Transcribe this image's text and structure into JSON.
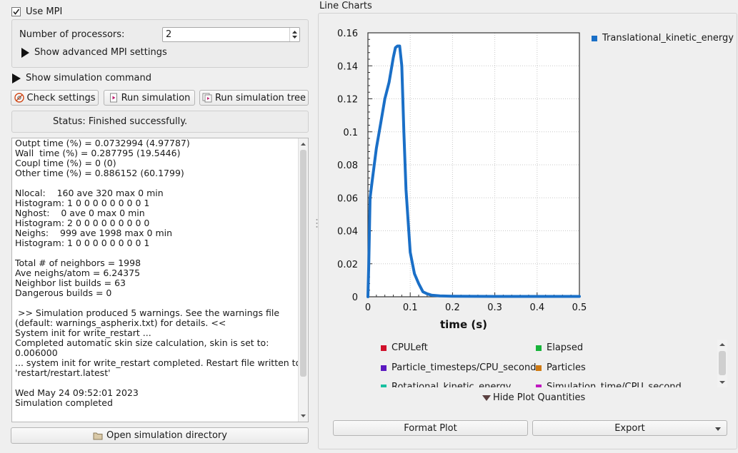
{
  "mpi": {
    "use_label": "Use MPI",
    "checked": true,
    "processors_label": "Number of processors:",
    "processors_value": "2",
    "advanced_label": "Show advanced MPI settings"
  },
  "sim": {
    "show_command_label": "Show simulation command"
  },
  "buttons": {
    "check": "Check settings",
    "run": "Run simulation",
    "run_tree": "Run simulation tree",
    "open_dir": "Open simulation directory"
  },
  "status": "Status: Finished successfully.",
  "log_lines": [
    "Outpt time (%) = 0.0732994 (4.97787)",
    "Wall  time (%) = 0.287795 (19.5446)",
    "Coupl time (%) = 0 (0)",
    "Other time (%) = 0.886152 (60.1799)",
    "",
    "Nlocal:    160 ave 320 max 0 min",
    "Histogram: 1 0 0 0 0 0 0 0 0 1",
    "Nghost:    0 ave 0 max 0 min",
    "Histogram: 2 0 0 0 0 0 0 0 0 0",
    "Neighs:    999 ave 1998 max 0 min",
    "Histogram: 1 0 0 0 0 0 0 0 0 1",
    "",
    "Total # of neighbors = 1998",
    "Ave neighs/atom = 6.24375",
    "Neighbor list builds = 63",
    "Dangerous builds = 0",
    "",
    " >> Simulation produced 5 warnings. See the warnings file",
    "(default: warnings_aspherix.txt) for details. <<",
    "System init for write_restart ...",
    "Completed automatic skin size calculation, skin is set to:",
    "0.006000",
    "... system init for write_restart completed. Restart file written to",
    "'restart/restart.latest'",
    "",
    "Wed May 24 09:52:01 2023",
    "Simulation completed"
  ],
  "charts": {
    "title": "Line Charts",
    "hide_label": "Hide Plot Quantities",
    "format_label": "Format Plot",
    "export_label": "Export"
  },
  "quantities": [
    {
      "name": "CPULeft",
      "color": "#d0102a"
    },
    {
      "name": "Elapsed",
      "color": "#18b43a"
    },
    {
      "name": "Particle_timesteps/CPU_second",
      "color": "#5a18c0"
    },
    {
      "name": "Particles",
      "color": "#cf7a12"
    },
    {
      "name": "Rotational_kinetic_energy",
      "color": "#18c0a0"
    },
    {
      "name": "Simulation_time/CPU_second",
      "color": "#c018c0"
    }
  ],
  "chart_data": {
    "type": "line",
    "xlabel": "time (s)",
    "ylabel": "",
    "xlim": [
      0,
      0.5
    ],
    "ylim": [
      0,
      0.16
    ],
    "x_ticks": [
      "0",
      "0.1",
      "0.2",
      "0.3",
      "0.4",
      "0.5"
    ],
    "y_ticks": [
      "0",
      "0.02",
      "0.04",
      "0.06",
      "0.08",
      "0.1",
      "0.12",
      "0.14",
      "0.16"
    ],
    "grid": true,
    "legend_position": "right",
    "series": [
      {
        "name": "Translational_kinetic_energy",
        "color": "#1a6fc7",
        "x": [
          0.0,
          0.002,
          0.005,
          0.01,
          0.02,
          0.03,
          0.04,
          0.05,
          0.06,
          0.065,
          0.07,
          0.075,
          0.08,
          0.085,
          0.09,
          0.1,
          0.11,
          0.12,
          0.13,
          0.14,
          0.15,
          0.17,
          0.2,
          0.3,
          0.4,
          0.5
        ],
        "y": [
          0.0,
          0.02,
          0.06,
          0.07,
          0.09,
          0.105,
          0.12,
          0.13,
          0.145,
          0.151,
          0.152,
          0.152,
          0.14,
          0.1,
          0.065,
          0.027,
          0.014,
          0.008,
          0.003,
          0.0018,
          0.001,
          0.0005,
          0.0003,
          0.0002,
          0.0002,
          0.0002
        ]
      }
    ]
  }
}
